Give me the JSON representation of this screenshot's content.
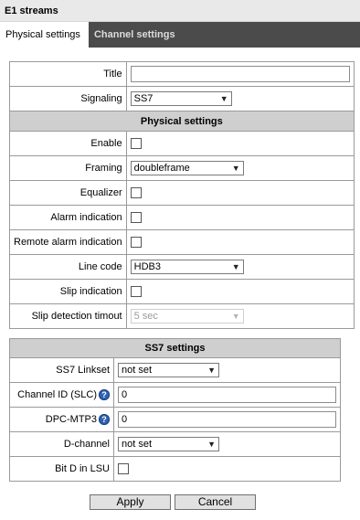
{
  "window": {
    "title": "E1 streams"
  },
  "tabs": [
    {
      "label": "Physical settings",
      "active": true
    },
    {
      "label": "Channel settings",
      "active": false
    }
  ],
  "general": {
    "title_label": "Title",
    "title_value": "",
    "signaling_label": "Signaling",
    "signaling_value": "SS7"
  },
  "physical": {
    "header": "Physical settings",
    "enable_label": "Enable",
    "framing_label": "Framing",
    "framing_value": "doubleframe",
    "equalizer_label": "Equalizer",
    "alarm_label": "Alarm indication",
    "remote_alarm_label": "Remote alarm indication",
    "line_code_label": "Line code",
    "line_code_value": "HDB3",
    "slip_indication_label": "Slip indication",
    "slip_detection_label": "Slip detection timout",
    "slip_detection_value": "5 sec"
  },
  "ss7": {
    "header": "SS7 settings",
    "linkset_label": "SS7 Linkset",
    "linkset_value": "not set",
    "channel_id_label": "Channel ID (SLC)",
    "channel_id_value": "0",
    "dpc_label": "DPC-MTP3",
    "dpc_value": "0",
    "dchannel_label": "D-channel",
    "dchannel_value": "not set",
    "bitd_label": "Bit D in LSU"
  },
  "buttons": {
    "apply": "Apply",
    "cancel": "Cancel"
  },
  "icons": {
    "help": "help-icon",
    "dropdown": "chevron-down-icon"
  },
  "colors": {
    "tab_bar": "#4b4b4b",
    "section_header": "#cfcfcf",
    "help_icon": "#2f62b4"
  }
}
